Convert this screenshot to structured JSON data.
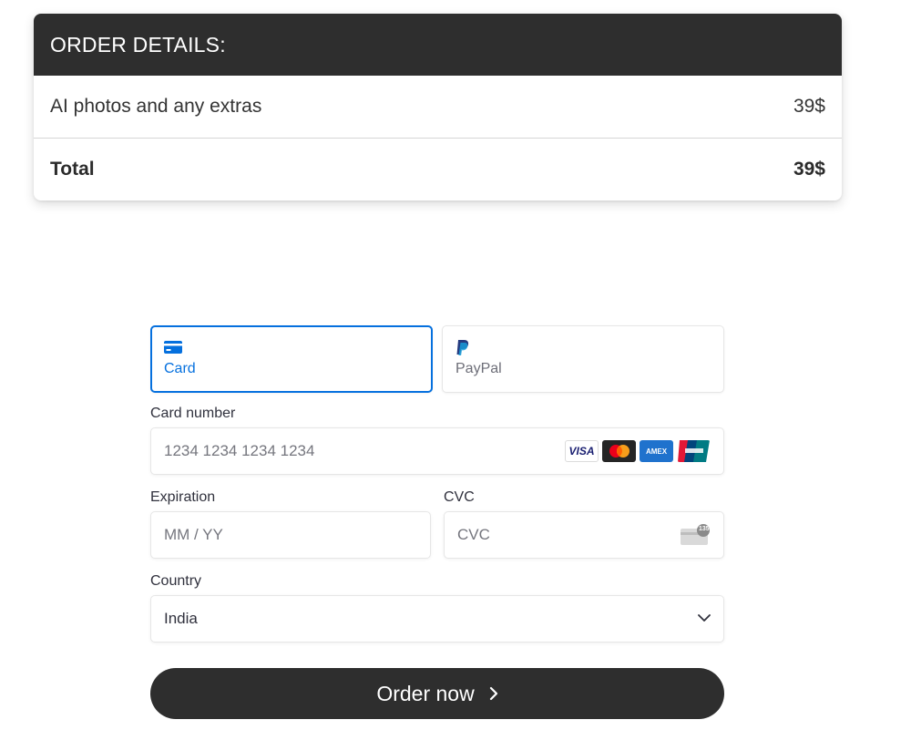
{
  "order": {
    "header": "ORDER DETAILS:",
    "items": [
      {
        "label": "AI photos and any extras",
        "price": "39$"
      }
    ],
    "total": {
      "label": "Total",
      "price": "39$"
    }
  },
  "payment": {
    "tabs": [
      {
        "label": "Card",
        "icon": "card-icon",
        "active": true
      },
      {
        "label": "PayPal",
        "icon": "paypal-icon",
        "active": false
      }
    ],
    "card_number": {
      "label": "Card number",
      "placeholder": "1234 1234 1234 1234",
      "value": ""
    },
    "card_brands": {
      "visa": "VISA",
      "amex": "AMEX",
      "names": [
        "visa",
        "mastercard",
        "amex",
        "unionpay"
      ]
    },
    "expiration": {
      "label": "Expiration",
      "placeholder": "MM / YY",
      "value": ""
    },
    "cvc": {
      "label": "CVC",
      "placeholder": "CVC",
      "value": "",
      "icon_badge": "135"
    },
    "country": {
      "label": "Country",
      "selected": "India"
    },
    "submit_label": "Order now",
    "accent_color": "#0570de"
  }
}
